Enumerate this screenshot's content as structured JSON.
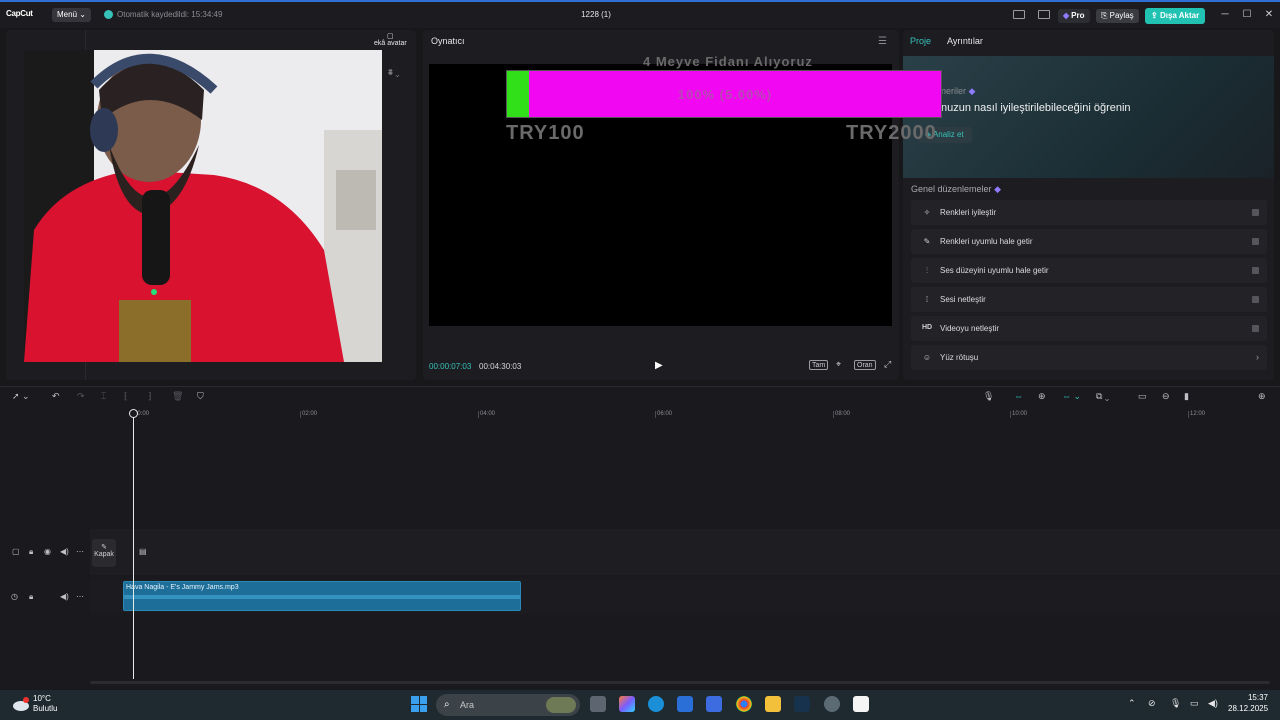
{
  "titlebar": {
    "logo": "CapCut",
    "menu_label": "Menü ⌄",
    "autosave_text": "Otomatik kaydedildi: 15:34:49",
    "project_title": "1228 (1)",
    "pro_label": "Pro",
    "share_label": "Paylaş",
    "export_label": "Dışa Aktar"
  },
  "media": {
    "avatar_tab": "ekâ avatar",
    "filter_label": "⩩ ⌄"
  },
  "player": {
    "title": "Oynatıcı",
    "time_current": "00:00:07:03",
    "time_total": "00:04:30:03",
    "ctrl_full": "Tam",
    "ctrl_ratio": "Oran"
  },
  "goal": {
    "title": "4 Meyve Fidanı Alıyoruz",
    "percent_text": "100% (5.00%)",
    "progress": 0.05,
    "min_label": "TRY100",
    "max_label": "TRY2000"
  },
  "right_panel": {
    "tab_project": "Proje",
    "tab_details": "Ayrıntılar",
    "hero_sub": "neriler",
    "hero_title": "nuzun nasıl iyileştirilebileceğini öğrenin",
    "analyze_label": "Analiz et",
    "general_title": "Genel düzenlemeler",
    "options": [
      {
        "icon": "wand-icon",
        "glyph": "✧",
        "label": "Renkleri iyileştir"
      },
      {
        "icon": "brush-icon",
        "glyph": "✎",
        "label": "Renkleri uyumlu hale getir"
      },
      {
        "icon": "sliders-icon",
        "glyph": "⫶",
        "label": "Ses düzeyini uyumlu hale getir"
      },
      {
        "icon": "audio-wave-icon",
        "glyph": "⁞",
        "label": "Sesi netleştir"
      },
      {
        "icon": "hd-icon",
        "glyph": "HD",
        "label": "Videoyu netleştir"
      },
      {
        "icon": "face-icon",
        "glyph": "☺",
        "label": "Yüz rötuşu"
      }
    ]
  },
  "timeline": {
    "ticks": [
      "00:00",
      "02:00",
      "04:00",
      "06:00",
      "08:00",
      "10:00",
      "12:00"
    ],
    "cover_label": "Kapak",
    "audio_clip_label": "Hava Nagila - E's Jammy Jams.mp3"
  },
  "taskbar": {
    "temp": "10°C",
    "weather": "Bulutlu",
    "search_placeholder": "Ara",
    "time": "15:37",
    "date": "28.12.2025"
  }
}
